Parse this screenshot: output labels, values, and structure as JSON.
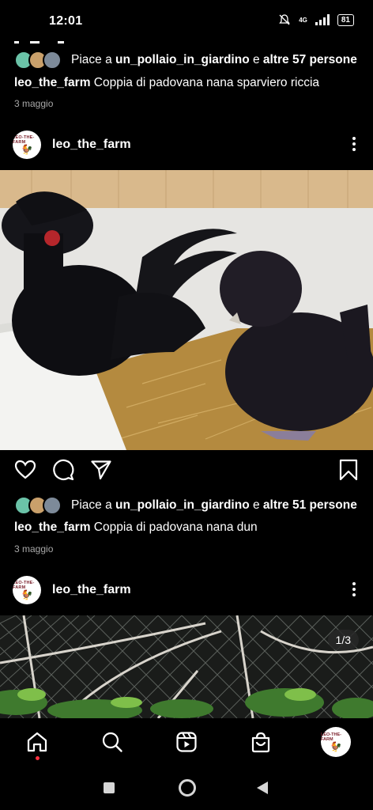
{
  "status_bar": {
    "time": "12:01",
    "network": "4G",
    "battery": "81"
  },
  "post1": {
    "likes": {
      "prefix": "Piace a",
      "user": "un_pollaio_in_giardino",
      "connector": "e",
      "others": "altre 57 persone"
    },
    "caption_user": "leo_the_farm",
    "caption_text": "Coppia di padovana nana sparviero riccia",
    "date": "3 maggio"
  },
  "post2": {
    "username": "leo_the_farm",
    "likes": {
      "prefix": "Piace a",
      "user": "un_pollaio_in_giardino",
      "connector": "e",
      "others": "altre 51 persone"
    },
    "caption_user": "leo_the_farm",
    "caption_text": "Coppia di padovana nana dun",
    "date": "3 maggio"
  },
  "post3": {
    "username": "leo_the_farm",
    "carousel_counter": "1/3"
  },
  "avatar_logo": {
    "text": "LEO-THE-FARM"
  },
  "icons": {
    "like": "heart-icon",
    "comment": "comment-icon",
    "share": "send-icon",
    "save": "bookmark-icon",
    "home": "home-icon",
    "search": "search-icon",
    "reels": "reels-icon",
    "shop": "shop-icon",
    "more": "more-vertical-icon"
  },
  "colors": {
    "background": "#000000",
    "text": "#ffffff",
    "secondary": "#a8a8a8",
    "notification_dot": "#ff3040"
  }
}
